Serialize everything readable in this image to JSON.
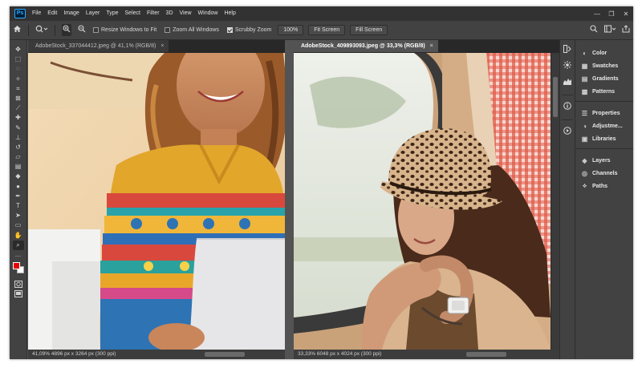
{
  "menu": {
    "logo": "Ps",
    "items": [
      "File",
      "Edit",
      "Image",
      "Layer",
      "Type",
      "Select",
      "Filter",
      "3D",
      "View",
      "Window",
      "Help"
    ],
    "window_controls": [
      "—",
      "❐",
      "✕"
    ]
  },
  "options_bar": {
    "resize_windows_label": "Resize Windows to Fit",
    "resize_windows_checked": false,
    "zoom_all_windows_label": "Zoom All Windows",
    "zoom_all_windows_checked": false,
    "scrubby_zoom_label": "Scrubby Zoom",
    "scrubby_zoom_checked": true,
    "zoom_value": "100%",
    "fit_screen_label": "Fit Screen",
    "fill_screen_label": "Fill Screen"
  },
  "toolbar": {
    "tools": [
      {
        "name": "move-tool",
        "glyph": "✥"
      },
      {
        "name": "marquee-tool",
        "glyph": "⬚"
      },
      {
        "name": "lasso-tool",
        "glyph": "◌"
      },
      {
        "name": "magic-wand-tool",
        "glyph": "✧"
      },
      {
        "name": "crop-tool",
        "glyph": "⌗"
      },
      {
        "name": "frame-tool",
        "glyph": "⊠"
      },
      {
        "name": "eyedropper-tool",
        "glyph": "⟋"
      },
      {
        "name": "healing-brush-tool",
        "glyph": "✚"
      },
      {
        "name": "brush-tool",
        "glyph": "✎"
      },
      {
        "name": "clone-stamp-tool",
        "glyph": "⊥"
      },
      {
        "name": "history-brush-tool",
        "glyph": "↺"
      },
      {
        "name": "eraser-tool",
        "glyph": "▱"
      },
      {
        "name": "gradient-tool",
        "glyph": "▤"
      },
      {
        "name": "blur-tool",
        "glyph": "◆"
      },
      {
        "name": "dodge-tool",
        "glyph": "●"
      },
      {
        "name": "pen-tool",
        "glyph": "✒"
      },
      {
        "name": "type-tool",
        "glyph": "T"
      },
      {
        "name": "path-selection-tool",
        "glyph": "➤"
      },
      {
        "name": "rectangle-tool",
        "glyph": "▭"
      },
      {
        "name": "hand-tool",
        "glyph": "✋"
      },
      {
        "name": "zoom-tool",
        "glyph": "⌕"
      },
      {
        "name": "more-tools",
        "glyph": "…"
      }
    ],
    "foreground_color": "#e60000",
    "background_color": "#ffffff"
  },
  "documents": [
    {
      "tab_title": "AdobeStock_337044412.jpeg @ 41,1% (RGB/8)",
      "active": false,
      "status": "41,09%   4896 px x 3264 px (300 ppi)"
    },
    {
      "tab_title": "AdobeStock_409893093.jpeg @ 33,3% (RGB/8)",
      "active": true,
      "status": "33,33%   6048 px x 4024 px (300 ppi)"
    }
  ],
  "panels": {
    "group1": [
      {
        "icon": "color-icon",
        "glyph": "◐",
        "label": "Color"
      },
      {
        "icon": "swatches-icon",
        "glyph": "▦",
        "label": "Swatches"
      },
      {
        "icon": "gradients-icon",
        "glyph": "▤",
        "label": "Gradients"
      },
      {
        "icon": "patterns-icon",
        "glyph": "▩",
        "label": "Patterns"
      }
    ],
    "group2": [
      {
        "icon": "properties-icon",
        "glyph": "☰",
        "label": "Properties"
      },
      {
        "icon": "adjustments-icon",
        "glyph": "◑",
        "label": "Adjustme..."
      },
      {
        "icon": "libraries-icon",
        "glyph": "▣",
        "label": "Libraries"
      }
    ],
    "group3": [
      {
        "icon": "layers-icon",
        "glyph": "◈",
        "label": "Layers"
      },
      {
        "icon": "channels-icon",
        "glyph": "◎",
        "label": "Channels"
      },
      {
        "icon": "paths-icon",
        "glyph": "⟡",
        "label": "Paths"
      }
    ]
  }
}
